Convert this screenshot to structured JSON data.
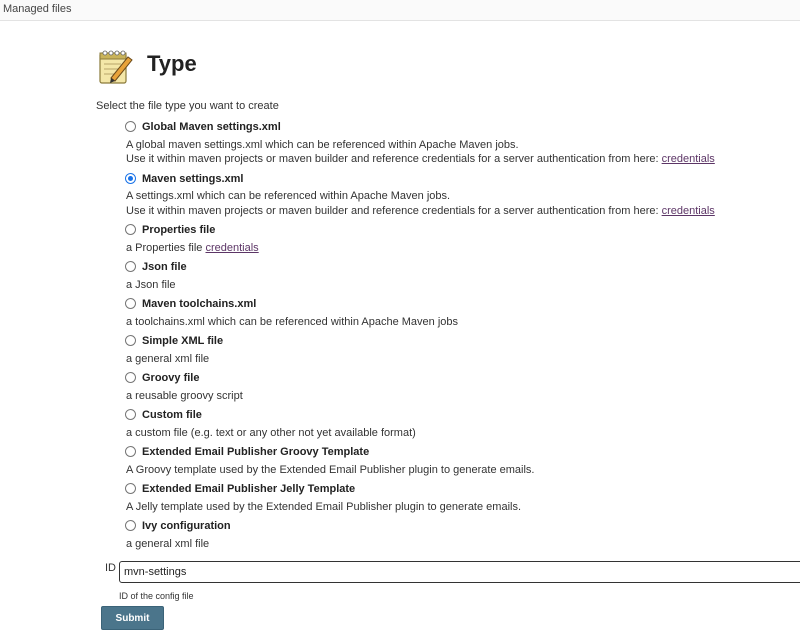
{
  "breadcrumb": "Managed files",
  "header": {
    "title": "Type",
    "icon": "notepad-pencil-icon"
  },
  "instruction": "Select the file type you want to create",
  "file_types": [
    {
      "label": "Global Maven settings.xml",
      "checked": false,
      "desc1": "A global maven settings.xml which can be referenced within Apache Maven jobs.",
      "desc2_prefix": "Use it within maven projects or maven builder and reference credentials for a server authentication from here: ",
      "desc2_link": "credentials"
    },
    {
      "label": "Maven settings.xml",
      "checked": true,
      "desc1": "A settings.xml which can be referenced within Apache Maven jobs.",
      "desc2_prefix": "Use it within maven projects or maven builder and reference credentials for a server authentication from here: ",
      "desc2_link": "credentials"
    },
    {
      "label": "Properties file",
      "checked": false,
      "desc1_prefix": "a Properties file ",
      "desc1_link": "credentials"
    },
    {
      "label": "Json file",
      "checked": false,
      "desc1": "a Json file"
    },
    {
      "label": "Maven toolchains.xml",
      "checked": false,
      "desc1": "a toolchains.xml which can be referenced within Apache Maven jobs"
    },
    {
      "label": "Simple XML file",
      "checked": false,
      "desc1": "a general xml file"
    },
    {
      "label": "Groovy file",
      "checked": false,
      "desc1": "a reusable groovy script"
    },
    {
      "label": "Custom file",
      "checked": false,
      "desc1": "a custom file (e.g. text or any other not yet available format)"
    },
    {
      "label": "Extended Email Publisher Groovy Template",
      "checked": false,
      "desc1": "A Groovy template used by the Extended Email Publisher plugin to generate emails."
    },
    {
      "label": "Extended Email Publisher Jelly Template",
      "checked": false,
      "desc1": "A Jelly template used by the Extended Email Publisher plugin to generate emails."
    },
    {
      "label": "Ivy configuration",
      "checked": false,
      "desc1": "a general xml file"
    }
  ],
  "id_field": {
    "label": "ID",
    "value": "mvn-settings",
    "help": "ID of the config file"
  },
  "submit_label": "Submit",
  "colors": {
    "link": "#5c3566",
    "submit_bg": "#4b758b",
    "radio_checked": "#1a73e8"
  }
}
